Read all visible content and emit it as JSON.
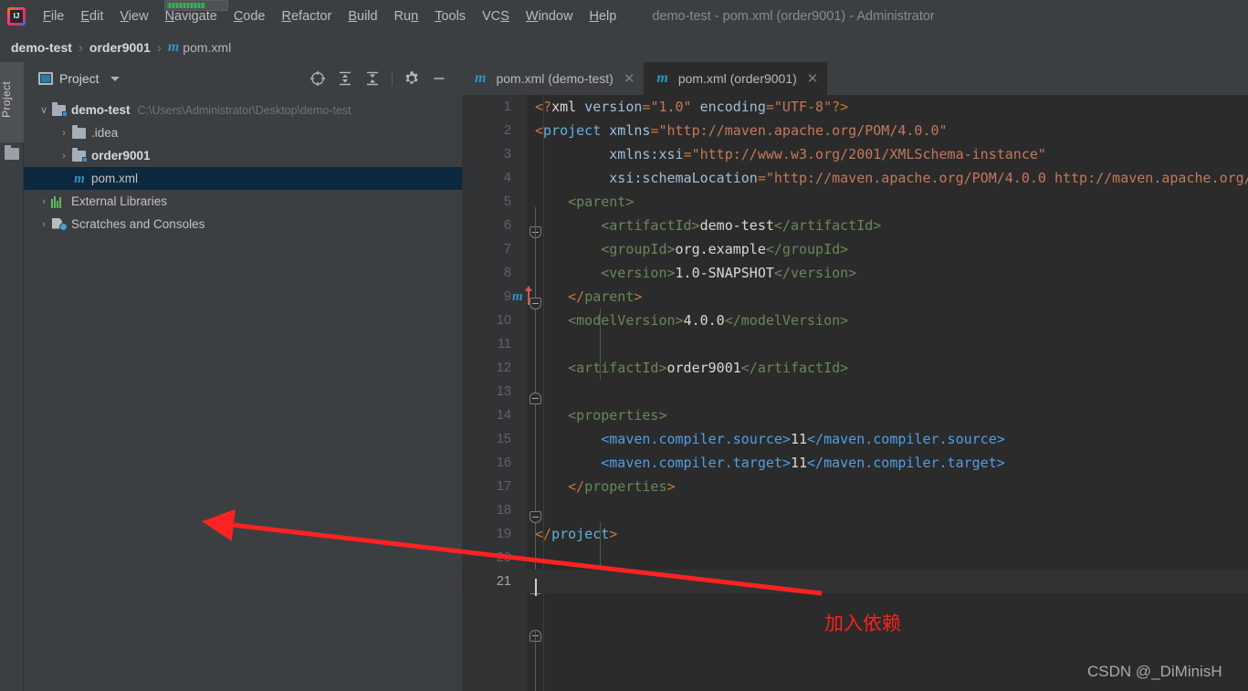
{
  "window": {
    "title": "demo-test - pom.xml (order9001) - Administrator",
    "logo_icon": "intellij-idea-logo"
  },
  "menubar": {
    "items": [
      {
        "label": "File",
        "mnemonic": "F"
      },
      {
        "label": "Edit",
        "mnemonic": "E"
      },
      {
        "label": "View",
        "mnemonic": "V"
      },
      {
        "label": "Navigate",
        "mnemonic": "N"
      },
      {
        "label": "Code",
        "mnemonic": "C"
      },
      {
        "label": "Refactor",
        "mnemonic": "R"
      },
      {
        "label": "Build",
        "mnemonic": "B"
      },
      {
        "label": "Run",
        "mnemonic": "n"
      },
      {
        "label": "Tools",
        "mnemonic": "T"
      },
      {
        "label": "VCS",
        "mnemonic": "S"
      },
      {
        "label": "Window",
        "mnemonic": "W"
      },
      {
        "label": "Help",
        "mnemonic": "H"
      }
    ]
  },
  "breadcrumb": {
    "segments": [
      "demo-test",
      "order9001"
    ],
    "separator": "›",
    "file": "pom.xml",
    "file_icon": "maven-m-icon"
  },
  "toolstrip": {
    "project_label": "Project",
    "folder_icon": "folder-icon"
  },
  "project_panel": {
    "title": "Project",
    "title_icon": "project-view-icon",
    "dropdown_icon": "chevron-down-icon",
    "tools": [
      {
        "name": "locate-icon",
        "glyph": "⊕"
      },
      {
        "name": "expand-all-icon",
        "glyph": "≡"
      },
      {
        "name": "collapse-all-icon",
        "glyph": "≡"
      },
      {
        "name": "settings-gear-icon",
        "glyph": "⚙"
      },
      {
        "name": "hide-panel-icon",
        "glyph": "—"
      }
    ],
    "tree": [
      {
        "label": "demo-test",
        "path": "C:\\Users\\Administrator\\Desktop\\demo-test",
        "icon": "module-folder-icon",
        "arrow": "∨",
        "indent": 0,
        "bold": true,
        "selected": false
      },
      {
        "label": ".idea",
        "path": "",
        "icon": "folder-icon",
        "arrow": "›",
        "indent": 1,
        "bold": false,
        "selected": false
      },
      {
        "label": "order9001",
        "path": "",
        "icon": "module-folder-icon",
        "arrow": "›",
        "indent": 1,
        "bold": true,
        "selected": false
      },
      {
        "label": "pom.xml",
        "path": "",
        "icon": "maven-m-icon",
        "arrow": "",
        "indent": 1,
        "bold": false,
        "selected": true
      },
      {
        "label": "External Libraries",
        "path": "",
        "icon": "libraries-icon",
        "arrow": "›",
        "indent": 0,
        "bold": false,
        "selected": false
      },
      {
        "label": "Scratches and Consoles",
        "path": "",
        "icon": "scratches-icon",
        "arrow": "›",
        "indent": 0,
        "bold": false,
        "selected": false
      }
    ]
  },
  "editor_tabs": [
    {
      "label": "pom.xml (demo-test)",
      "icon": "maven-m-icon",
      "close": "✕",
      "active": false
    },
    {
      "label": "pom.xml (order9001)",
      "icon": "maven-m-icon",
      "close": "✕",
      "active": true
    }
  ],
  "editor": {
    "current_line": 21,
    "lines": [
      {
        "n": 1,
        "text": "<?xml version=\"1.0\" encoding=\"UTF-8\"?>"
      },
      {
        "n": 2,
        "text": "<project xmlns=\"http://maven.apache.org/POM/4.0.0\""
      },
      {
        "n": 3,
        "text": "         xmlns:xsi=\"http://www.w3.org/2001/XMLSchema-instance\""
      },
      {
        "n": 4,
        "text": "         xsi:schemaLocation=\"http://maven.apache.org/POM/4.0.0 http://maven.apache.org/"
      },
      {
        "n": 5,
        "text": "    <parent>"
      },
      {
        "n": 6,
        "text": "        <artifactId>demo-test</artifactId>"
      },
      {
        "n": 7,
        "text": "        <groupId>org.example</groupId>"
      },
      {
        "n": 8,
        "text": "        <version>1.0-SNAPSHOT</version>"
      },
      {
        "n": 9,
        "text": "    </parent>"
      },
      {
        "n": 10,
        "text": "    <modelVersion>4.0.0</modelVersion>"
      },
      {
        "n": 11,
        "text": ""
      },
      {
        "n": 12,
        "text": "    <artifactId>order9001</artifactId>"
      },
      {
        "n": 13,
        "text": ""
      },
      {
        "n": 14,
        "text": "    <properties>"
      },
      {
        "n": 15,
        "text": "        <maven.compiler.source>11</maven.compiler.source>"
      },
      {
        "n": 16,
        "text": "        <maven.compiler.target>11</maven.compiler.target>"
      },
      {
        "n": 17,
        "text": "    </properties>"
      },
      {
        "n": 18,
        "text": ""
      },
      {
        "n": 19,
        "text": "</project>"
      },
      {
        "n": 20,
        "text": ""
      },
      {
        "n": 21,
        "text": ""
      }
    ],
    "gutter_maven_icon": "maven-module-icon",
    "gutter_parent_arrow_icon": "navigate-to-parent-arrow-icon"
  },
  "annotation": {
    "text": "加入依赖",
    "color": "#ff1f1f",
    "arrow_icon": "red-arrow-icon"
  },
  "watermark": {
    "text": "CSDN @_DiMinisH"
  }
}
